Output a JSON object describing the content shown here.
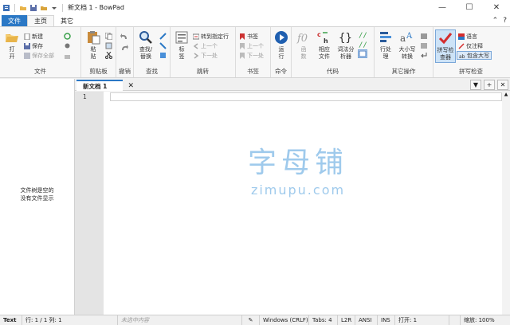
{
  "window": {
    "title": "新文档 1 - BowPad",
    "controls": [
      "—",
      "☐",
      "✕"
    ]
  },
  "ribbon_tabs": [
    "文件",
    "主页",
    "其它"
  ],
  "ribbon": {
    "file_group": {
      "label": "文件",
      "open": "打\n开",
      "new": "新建",
      "save": "保存",
      "save_all": "保存全部"
    },
    "clipboard_group": {
      "label": "剪贴板",
      "paste": "粘\n贴"
    },
    "undo_group": {
      "label": "撤销"
    },
    "find_group": {
      "label": "查找",
      "find_replace": "查找/\n替换"
    },
    "jump_group": {
      "label": "跳转",
      "goto": "标\n签",
      "goto_line": "转到指定行",
      "prev": "上一个",
      "next": "下一处"
    },
    "bookmark_group": {
      "label": "书签",
      "toggle": "书签",
      "prev": "上一个",
      "next": "下一处"
    },
    "command_group": {
      "label": "命令",
      "run": "运\n行"
    },
    "code_group": {
      "label": "代码",
      "function": "函\n数",
      "corresponding": "相应\n文件",
      "lexer": "词法分\n析器"
    },
    "other_group": {
      "label": "其它操作",
      "processing": "行处\n理",
      "case": "大小写\n转换"
    },
    "spell_group": {
      "label": "拼写检查",
      "checker": "拼写检\n查器",
      "language": "语言",
      "ignore": "仅注释",
      "case_toggle": "包含大写"
    }
  },
  "left_panel": {
    "message_line1": "文件树是空的",
    "message_line2": "没有文件显示"
  },
  "editor": {
    "tab_label": "新文档 1",
    "line_number": "1",
    "tab_tools": [
      "▼",
      "+",
      "✕"
    ]
  },
  "watermark": {
    "line1": "字母铺",
    "line2": "zimupu.com"
  },
  "status_bar": {
    "lexer": "Text",
    "position": "行: 1 / 1   列: 1",
    "selection": "未选中内容",
    "eol": "Windows (CRLF)",
    "tabs": "Tabs: 4",
    "direction": "L2R",
    "encoding": "ANSI",
    "insert": "INS",
    "open_count": "打开: 1",
    "zoom": "缩放: 100%"
  }
}
